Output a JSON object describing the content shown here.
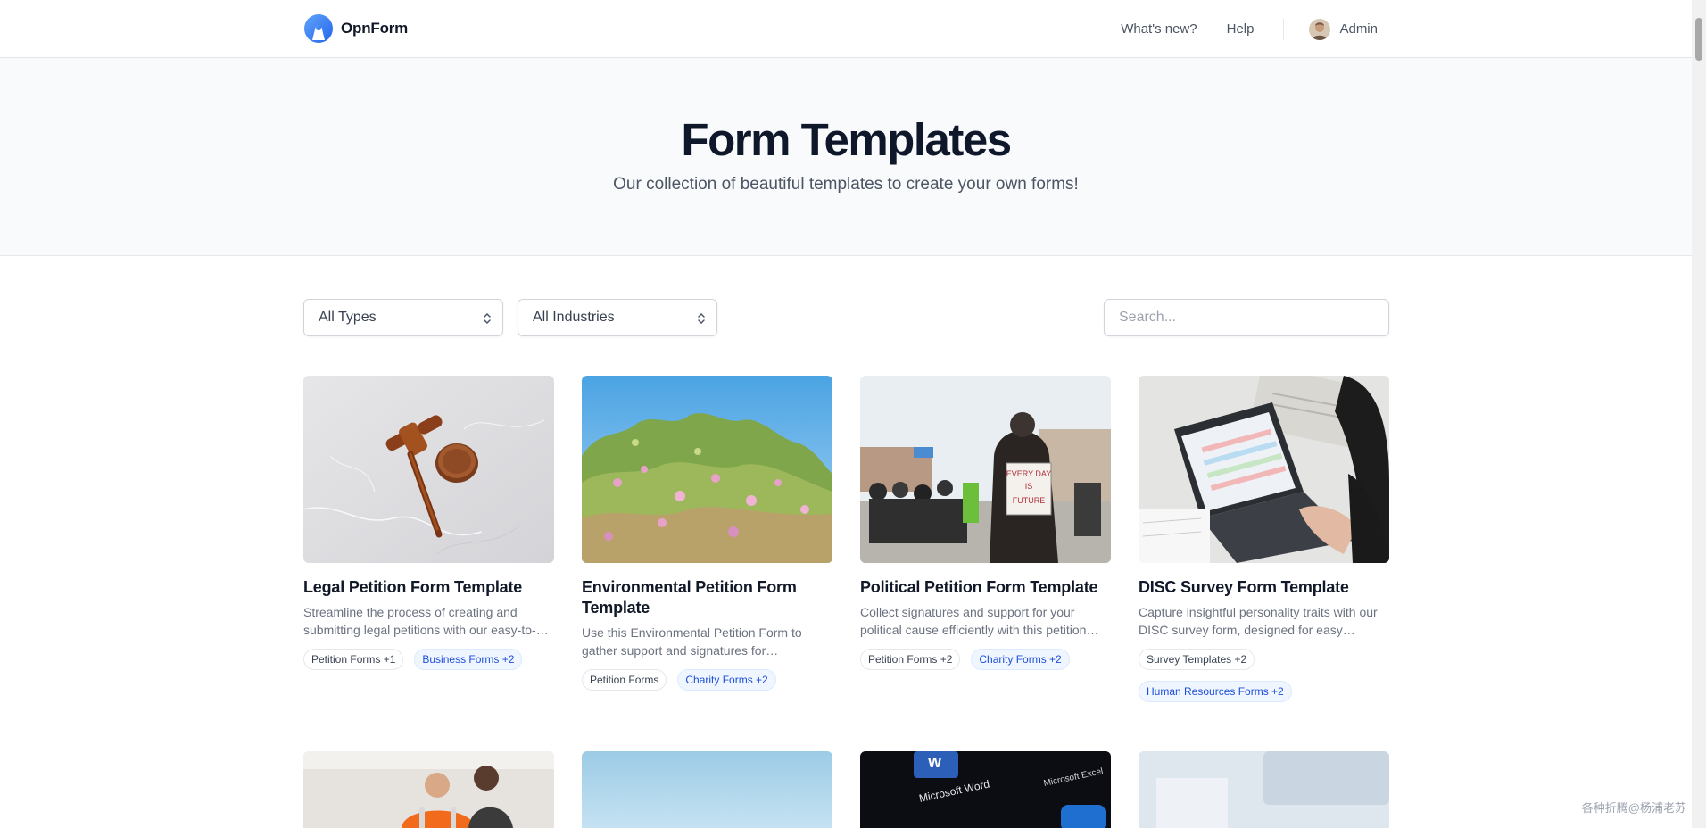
{
  "navbar": {
    "brand": "OpnForm",
    "links": [
      "What's new?",
      "Help"
    ],
    "user_name": "Admin"
  },
  "hero": {
    "title": "Form Templates",
    "subtitle": "Our collection of beautiful templates to create your own forms!"
  },
  "filters": {
    "types": "All Types",
    "industries": "All Industries",
    "search_placeholder": "Search..."
  },
  "templates": [
    {
      "title": "Legal Petition Form Template",
      "description": "Streamline the process of creating and submitting legal petitions with our easy-to-use form template.",
      "tags": [
        "Petition Forms +1",
        "Business Forms +2"
      ]
    },
    {
      "title": "Environmental Petition Form Template",
      "description": "Use this Environmental Petition Form to gather support and signatures for environmental causes.",
      "tags": [
        "Petition Forms",
        "Charity Forms +2"
      ]
    },
    {
      "title": "Political Petition Form Template",
      "description": "Collect signatures and support for your political cause efficiently with this petition form.",
      "tags": [
        "Petition Forms +2",
        "Charity Forms +2"
      ]
    },
    {
      "title": "DISC Survey Form Template",
      "description": "Capture insightful personality traits with our DISC survey form, designed for easy assessment.",
      "tags": [
        "Survey Templates +2",
        "Human Resources Forms +2"
      ]
    }
  ],
  "second_row_images": [
    "workers-meeting-image",
    "sky-image",
    "office-apps-image",
    "blurred-screen-image"
  ],
  "sign_text": [
    "EVERY DAY",
    "IS",
    "FUTURE"
  ],
  "app_labels": [
    "Microsoft Word",
    "Microsoft Excel"
  ],
  "watermark": "各种折腾@杨浦老苏",
  "colors": {
    "brand": "#3b82f6",
    "tag_blue_bg": "#eff6ff",
    "tag_blue_text": "#1d4ed8",
    "hero_bg": "#f8fafc"
  }
}
